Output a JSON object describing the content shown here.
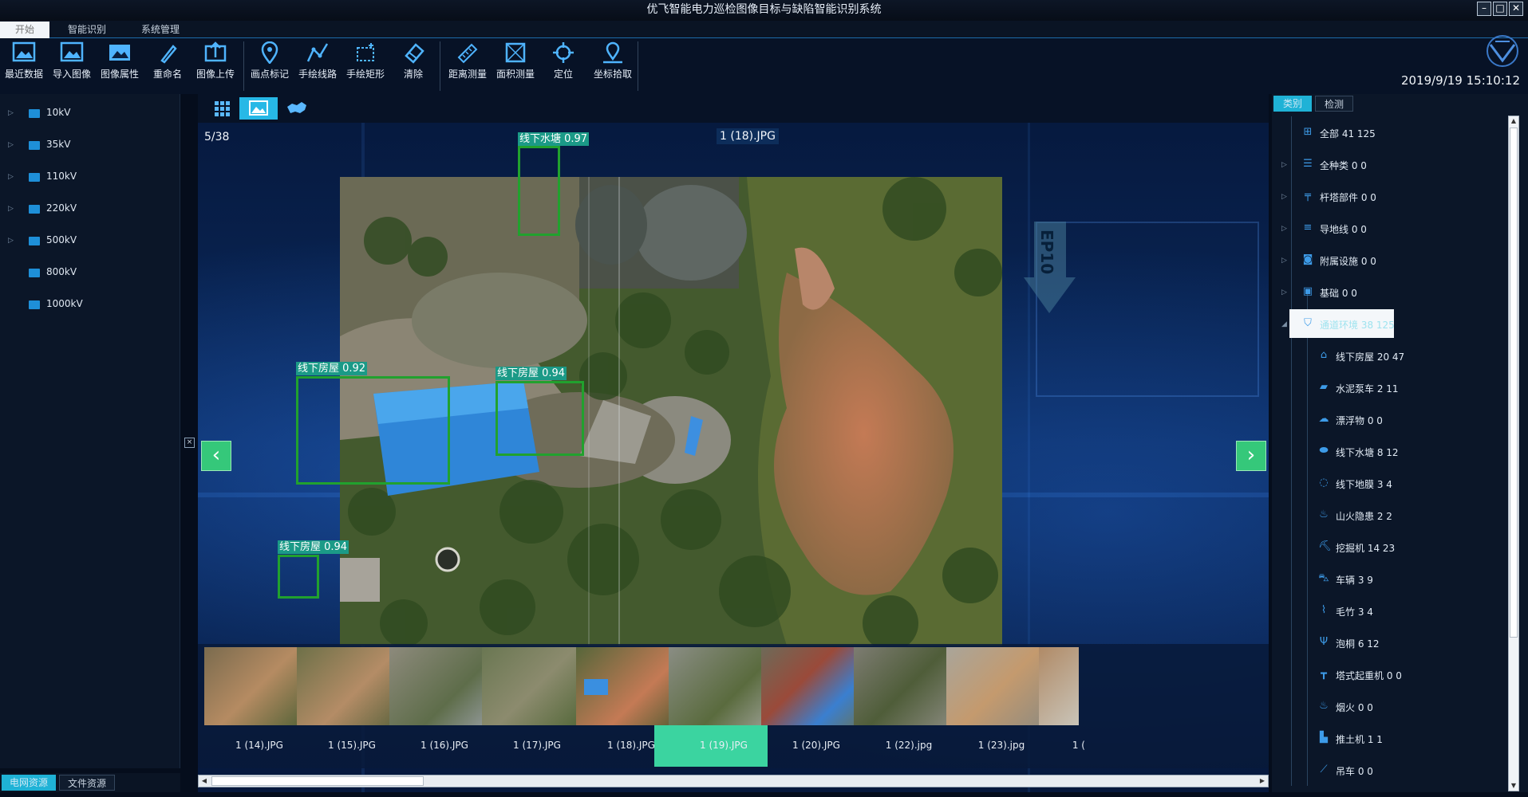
{
  "window": {
    "title": "优飞智能电力巡检图像目标与缺陷智能识别系统"
  },
  "menu": {
    "tabs": [
      "开始",
      "智能识别",
      "系统管理"
    ]
  },
  "toolbar": {
    "buttons": [
      "最近数据",
      "导入图像",
      "图像属性",
      "重命名",
      "图像上传",
      "画点标记",
      "手绘线路",
      "手绘矩形",
      "清除",
      "距离测量",
      "面积测量",
      "定位",
      "坐标拾取"
    ],
    "datetime": "2019/9/19 15:10:12"
  },
  "left_tree": {
    "items": [
      "10kV",
      "35kV",
      "110kV",
      "220kV",
      "500kV",
      "800kV",
      "1000kV"
    ]
  },
  "left_tabs": [
    "电网资源",
    "文件资源"
  ],
  "viewer": {
    "counter": "5/38",
    "filename": "1 (18).JPG",
    "detections": [
      {
        "label": "线下水塘 0.97"
      },
      {
        "label": "线下房屋 0.92"
      },
      {
        "label": "线下房屋 0.94"
      },
      {
        "label": "线下房屋 0.94"
      }
    ],
    "watermark": "EP10"
  },
  "thumbnails": {
    "items": [
      "1 (14).JPG",
      "1 (15).JPG",
      "1 (16).JPG",
      "1 (17).JPG",
      "1 (18).JPG",
      "1 (19).JPG",
      "1 (20).JPG",
      "1 (22).jpg",
      "1 (23).jpg",
      "1 ("
    ],
    "selected": "1 (18).JPG"
  },
  "right_tabs": [
    "类别",
    "检测"
  ],
  "right_tree": {
    "items": [
      {
        "label": "全部 41 125",
        "icon": "grid-icon"
      },
      {
        "label": "全种类 0 0",
        "icon": "list-icon"
      },
      {
        "label": "杆塔部件 0 0",
        "icon": "tower-icon"
      },
      {
        "label": "导地线 0 0",
        "icon": "lines-icon"
      },
      {
        "label": "附属设施 0 0",
        "icon": "camera-icon"
      },
      {
        "label": "基础 0 0",
        "icon": "foundation-icon"
      },
      {
        "label": "通道环境 38 125",
        "icon": "map-icon"
      },
      {
        "label": "线下房屋 20 47",
        "icon": "house-icon"
      },
      {
        "label": "水泥泵车 2 11",
        "icon": "pump-truck-icon"
      },
      {
        "label": "漂浮物 0 0",
        "icon": "float-icon"
      },
      {
        "label": "线下水塘 8 12",
        "icon": "pond-icon"
      },
      {
        "label": "线下地膜 3 4",
        "icon": "film-icon"
      },
      {
        "label": "山火隐患 2 2",
        "icon": "fire-icon"
      },
      {
        "label": "挖掘机 14 23",
        "icon": "excavator-icon"
      },
      {
        "label": "车辆 3 9",
        "icon": "car-icon"
      },
      {
        "label": "毛竹 3 4",
        "icon": "bamboo-icon"
      },
      {
        "label": "泡桐 6 12",
        "icon": "tree-icon"
      },
      {
        "label": "塔式起重机 0 0",
        "icon": "crane-icon"
      },
      {
        "label": "烟火 0 0",
        "icon": "smoke-icon"
      },
      {
        "label": "推土机 1 1",
        "icon": "bulldozer-icon"
      },
      {
        "label": "吊车 0 0",
        "icon": "crane-truck-icon"
      }
    ]
  },
  "colors": {
    "accent": "#3bd4a0",
    "bbox": "#21a12e",
    "label_bg": "#1b9a87",
    "nav": "#35c87a"
  }
}
